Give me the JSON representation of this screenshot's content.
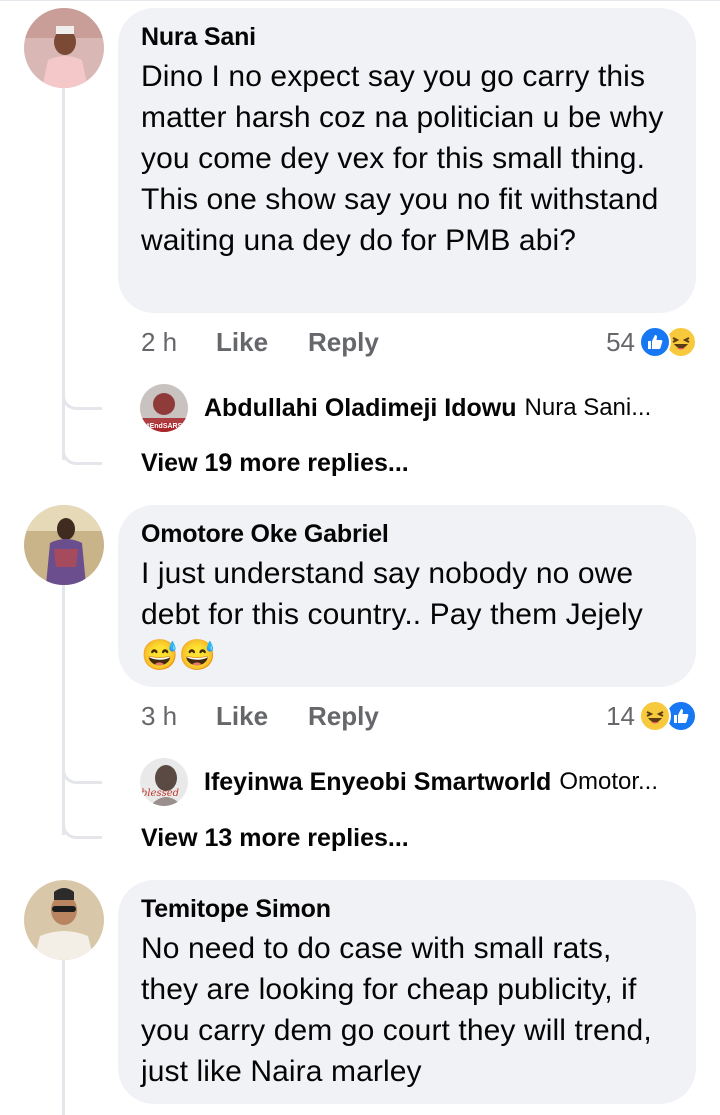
{
  "comments": [
    {
      "author": "Nura Sani",
      "text": "Dino I no expect say you go carry this matter harsh coz na politician u be why you come dey vex for this small thing. This one show say you no fit withstand waiting una dey do for PMB abi?",
      "time": "2 h",
      "like_label": "Like",
      "reply_label": "Reply",
      "reaction_count": "54",
      "reactions": [
        "like-icon",
        "haha-icon"
      ],
      "top_reply": {
        "author": "Abdullahi Oladimeji Idowu",
        "preview": "Nura Sani...",
        "avatar_badge": "#EndSARS"
      },
      "more_replies": "View 19 more replies..."
    },
    {
      "author": "Omotore Oke Gabriel",
      "text": "I just understand say nobody no owe debt for this country..  Pay them Jejely😅😅",
      "time": "3 h",
      "like_label": "Like",
      "reply_label": "Reply",
      "reaction_count": "14",
      "reactions": [
        "haha-icon",
        "like-icon"
      ],
      "top_reply": {
        "author": "Ifeyinwa Enyeobi Smartworld",
        "preview": "Omotor...",
        "avatar_badge": "blessed"
      },
      "more_replies": "View 13 more replies..."
    },
    {
      "author": "Temitope Simon",
      "text": "No need to do case with small rats, they are looking for cheap publicity, if you carry dem go court they will trend, just like Naira marley"
    }
  ],
  "colors": {
    "bubble": "#f0f2f5",
    "meta": "#65676b",
    "like_blue": "#1877f2",
    "haha_yellow": "#f7c93c",
    "thread_line": "#e4e6eb"
  }
}
